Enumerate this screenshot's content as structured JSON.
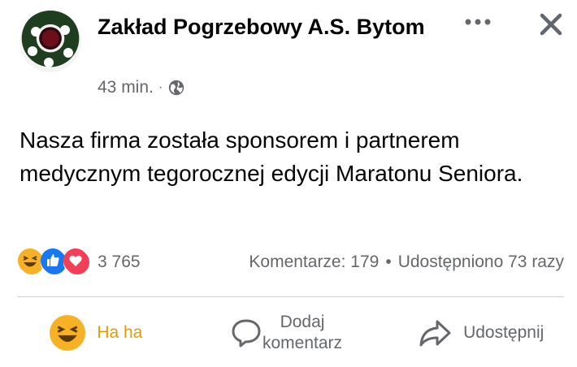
{
  "post": {
    "page_name": "Zakład Pogrzebowy A.S. Bytom",
    "time": "43 min.",
    "separator": "·",
    "privacy_icon": "globe-icon",
    "text": "Nasza firma została sponsorem i partnerem medycznym tegorocznej edycji Maratonu Seniora."
  },
  "header_actions": {
    "more_icon": "more-dots-icon",
    "close_icon": "close-icon"
  },
  "reactions": {
    "icons": [
      "haha-icon",
      "like-icon",
      "love-icon"
    ],
    "count": "3 765",
    "comments": "Komentarze: 179",
    "separator": "•",
    "shares": "Udostępniono 73 razy"
  },
  "actions": {
    "haha_label": "Ha ha",
    "comment_label": "Dodaj komentarz",
    "share_label": "Udostępnij"
  },
  "colors": {
    "haha": "#e69a00",
    "like": "#1877f2",
    "love": "#f33e58",
    "secondary_text": "#65676b"
  }
}
